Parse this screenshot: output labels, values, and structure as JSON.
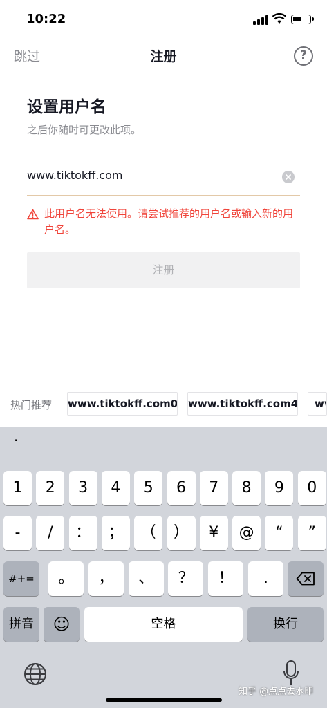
{
  "status_bar": {
    "time": "10:22"
  },
  "nav": {
    "skip_label": "跳过",
    "title": "注册",
    "help_symbol": "?"
  },
  "form": {
    "heading": "设置用户名",
    "subheading": "之后你随时可更改此项。",
    "username_value": "www.tiktokff.com",
    "error_message": "此用户名无法使用。请尝试推荐的用户名或输入新的用户名。",
    "submit_label": "注册"
  },
  "suggestions": {
    "label": "热门推荐",
    "items": [
      "www.tiktokff.com0",
      "www.tiktokff.com4",
      "www"
    ]
  },
  "keyboard": {
    "dot": "·",
    "row1": [
      "1",
      "2",
      "3",
      "4",
      "5",
      "6",
      "7",
      "8",
      "9",
      "0"
    ],
    "row2": [
      "-",
      "/",
      "：",
      "；",
      "（",
      "）",
      "¥",
      "@",
      "“",
      "”"
    ],
    "row3_left": "#+=",
    "row3": [
      "。",
      "，",
      "、",
      "？",
      "！",
      "."
    ],
    "pinyin": "拼音",
    "emoji": "☺",
    "space": "空格",
    "return": "换行"
  },
  "watermark": "知乎 @点点去水印",
  "colors": {
    "error": "#f0443a",
    "underline": "#e3c9a8",
    "keyboard_bg": "#d2d5db"
  }
}
